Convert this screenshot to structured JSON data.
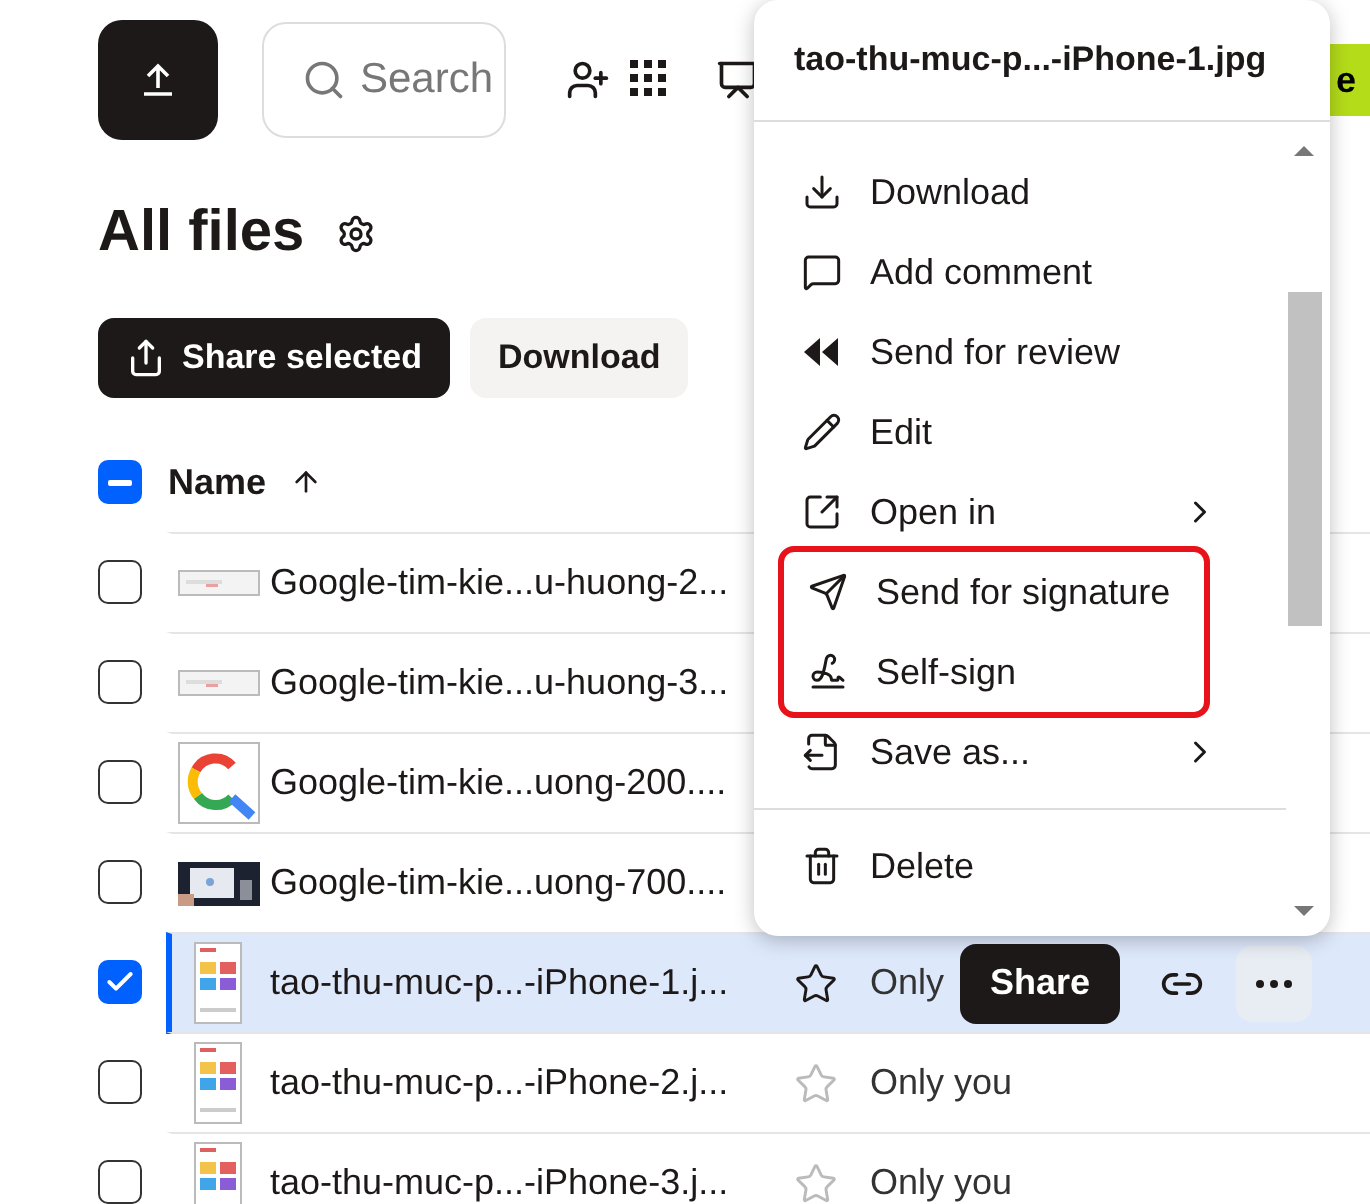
{
  "toolbar": {
    "search": {
      "placeholder": "Search"
    },
    "green_button": "e"
  },
  "title": "All files",
  "actions": [
    {
      "label": "Share selected",
      "kind": "primary"
    },
    {
      "label": "Download",
      "kind": "secondary"
    }
  ],
  "table": {
    "header": {
      "label": "Name",
      "indeterminate": true
    },
    "rows": [
      {
        "name": "Google-tim-kie...u-huong-2...",
        "checked": false,
        "selected": false
      },
      {
        "name": "Google-tim-kie...u-huong-3...",
        "checked": false,
        "selected": false
      },
      {
        "name": "Google-tim-kie...uong-200....",
        "checked": false,
        "selected": false
      },
      {
        "name": "Google-tim-kie...uong-700....",
        "checked": false,
        "selected": false
      },
      {
        "name": "tao-thu-muc-p...-iPhone-1.j...",
        "checked": true,
        "selected": true,
        "access": "Only",
        "share": "Share"
      },
      {
        "name": "tao-thu-muc-p...-iPhone-2.j...",
        "checked": false,
        "selected": false,
        "access": "Only you"
      },
      {
        "name": "tao-thu-muc-p...-iPhone-3.j...",
        "checked": false,
        "selected": false,
        "access": "Only you"
      }
    ]
  },
  "menu": {
    "title": "tao-thu-muc-p...-iPhone-1.jpg",
    "items": [
      {
        "label": "Download",
        "submenu": false,
        "highlighted": false
      },
      {
        "label": "Add comment",
        "submenu": false,
        "highlighted": false
      },
      {
        "label": "Send for review",
        "submenu": false,
        "highlighted": false
      },
      {
        "label": "Edit",
        "submenu": false,
        "highlighted": false
      },
      {
        "label": "Open in",
        "submenu": true,
        "highlighted": false
      },
      {
        "label": "Send for signature",
        "submenu": false,
        "highlighted": true
      },
      {
        "label": "Self-sign",
        "submenu": false,
        "highlighted": true
      },
      {
        "label": "Save as...",
        "submenu": true,
        "highlighted": false
      },
      {
        "label": "Delete",
        "submenu": false,
        "highlighted": false,
        "divider_before": true
      }
    ]
  }
}
